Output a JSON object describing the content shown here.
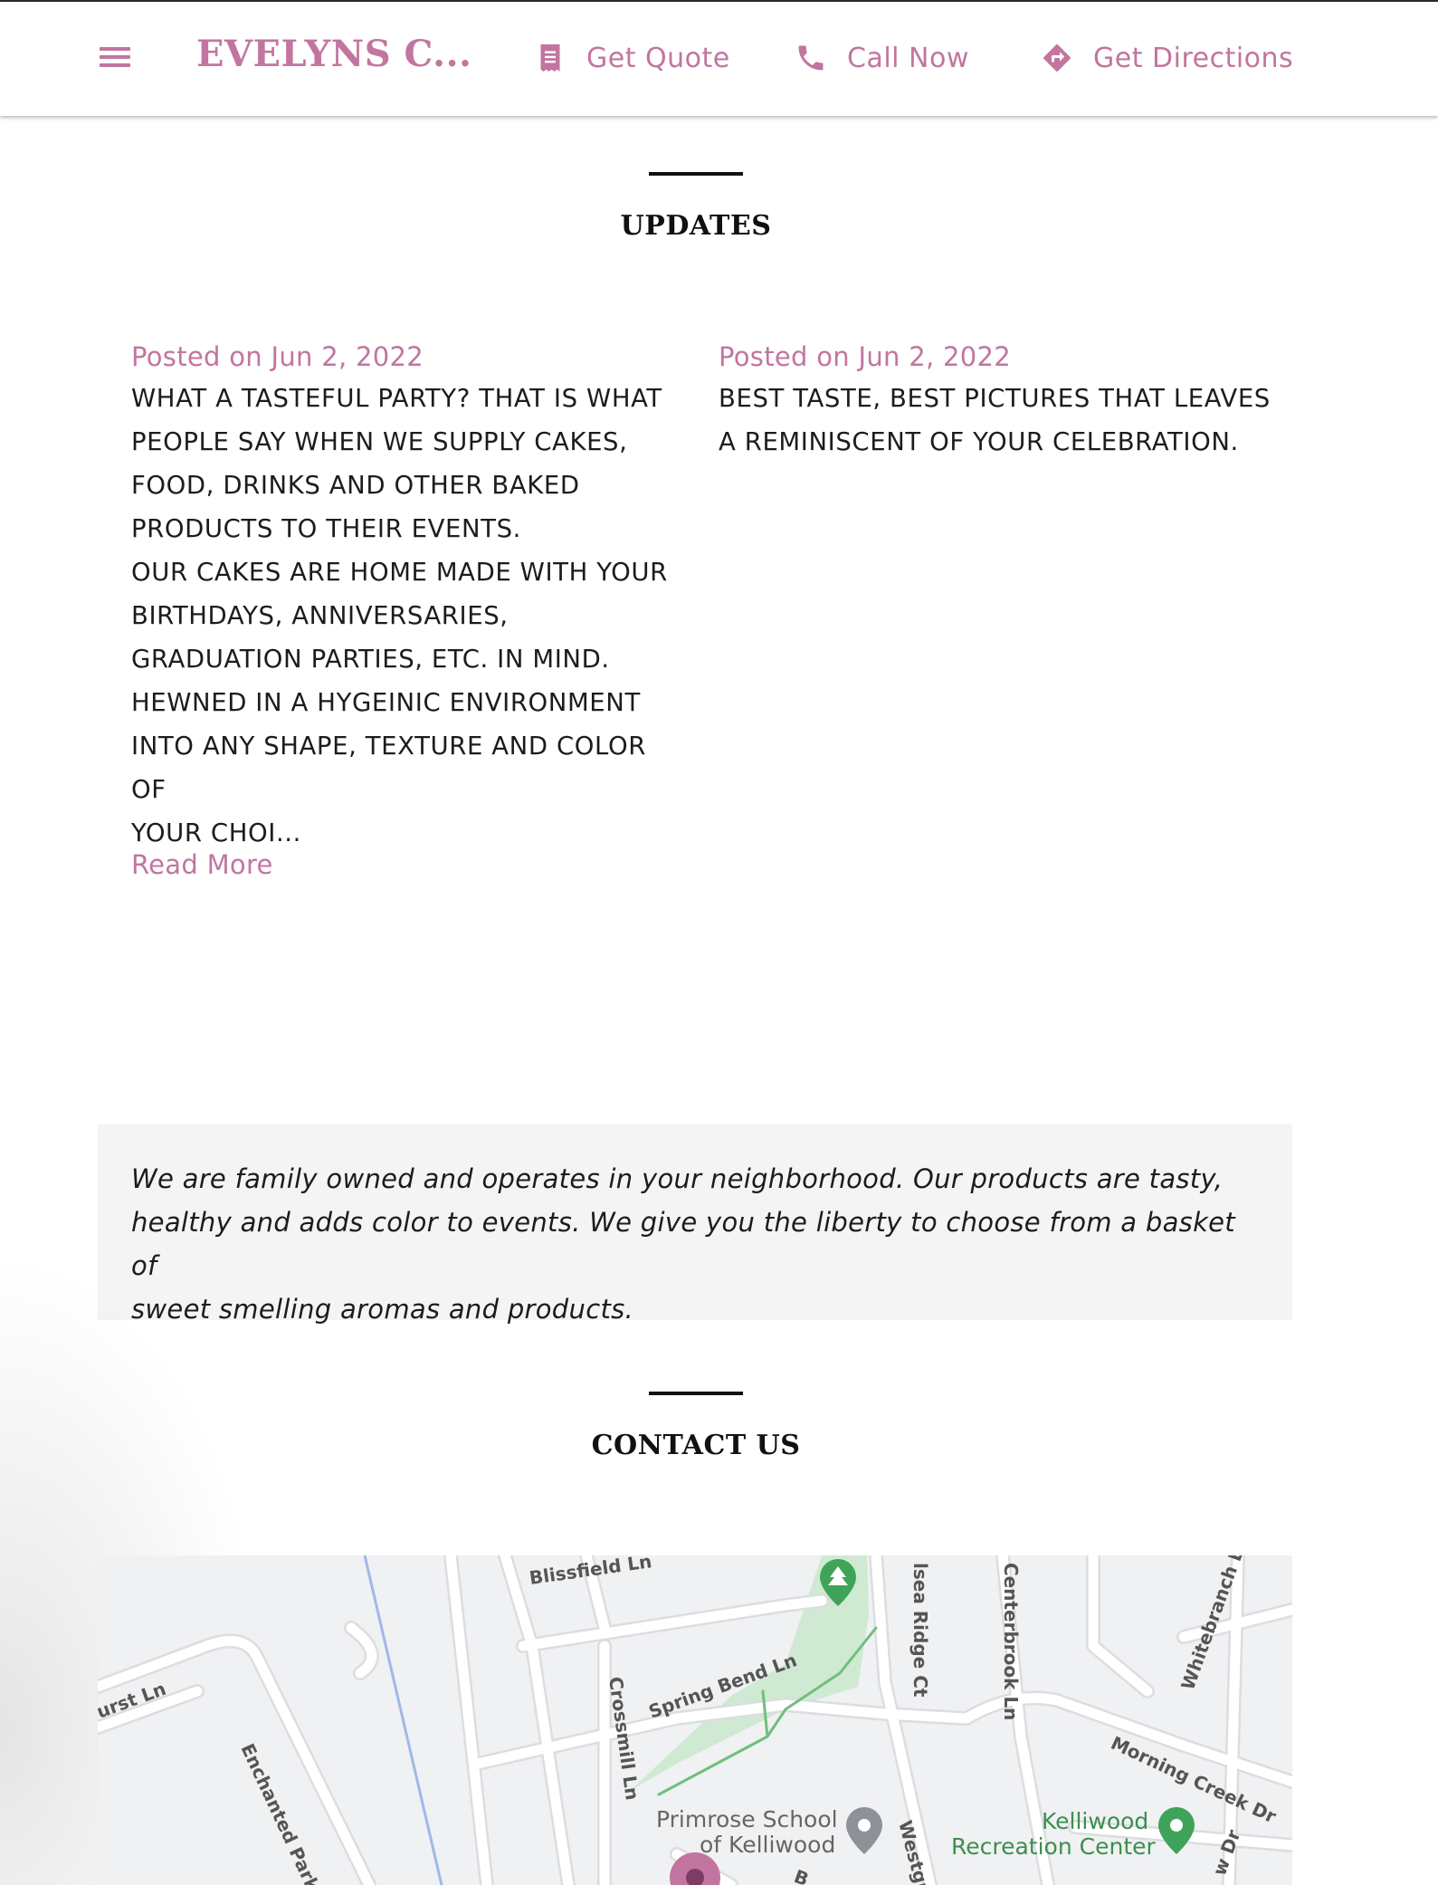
{
  "header": {
    "brand": "EVELYNS C...",
    "nav": [
      {
        "label": "Get Quote",
        "icon": "quote-icon"
      },
      {
        "label": "Call Now",
        "icon": "phone-icon"
      },
      {
        "label": "Get Directions",
        "icon": "directions-icon"
      }
    ]
  },
  "updates": {
    "title": "UPDATES",
    "posts": [
      {
        "date": "Posted on Jun 2, 2022",
        "lines": [
          "WHAT A TASTEFUL PARTY? THAT IS WHAT",
          "PEOPLE SAY WHEN WE SUPPLY CAKES,",
          "FOOD, DRINKS AND OTHER BAKED",
          "PRODUCTS TO THEIR EVENTS.",
          "OUR CAKES ARE HOME MADE WITH YOUR",
          "BIRTHDAYS, ANNIVERSARIES,",
          "GRADUATION PARTIES, ETC. IN MIND.",
          "HEWNED IN A HYGEINIC ENVIRONMENT",
          "INTO ANY SHAPE, TEXTURE AND COLOR OF",
          "YOUR CHOI..."
        ],
        "read_more": "Read More"
      },
      {
        "date": "Posted on Jun 2, 2022",
        "lines": [
          "BEST TASTE, BEST PICTURES THAT LEAVES",
          "A REMINISCENT OF YOUR CELEBRATION."
        ]
      }
    ]
  },
  "about": {
    "lines": [
      "We are family owned and operates in your neighborhood. Our products are tasty,",
      "healthy and adds color to events. We give you the liberty to choose from a basket of",
      "sweet smelling aromas and products."
    ]
  },
  "contact": {
    "title": "CONTACT US"
  },
  "map": {
    "streets": [
      "Blissfield Ln",
      "urst Ln",
      "Enchanted Park",
      "Crossmill Ln",
      "Spring Bend Ln",
      "lsea Ridge Ct",
      "Centerbrook Ln",
      "Whitebranch Ln",
      "Morning Creek Dr",
      "Westgr",
      "w Dr",
      "B"
    ],
    "places": [
      {
        "line1": "Primrose School",
        "line2": "of Kelliwood",
        "pin": "gray"
      },
      {
        "line1": "Kelliwood",
        "line2": "Recreation Center",
        "pin": "green"
      }
    ],
    "colors": {
      "place_text": "#666666",
      "rec_text": "#3c8f4f",
      "park": "#cfe9d2",
      "marker": "#c2759f"
    }
  },
  "theme": {
    "accent": "#c2759f",
    "text": "#1c1c1c",
    "panel_bg": "#f4f4f5"
  }
}
